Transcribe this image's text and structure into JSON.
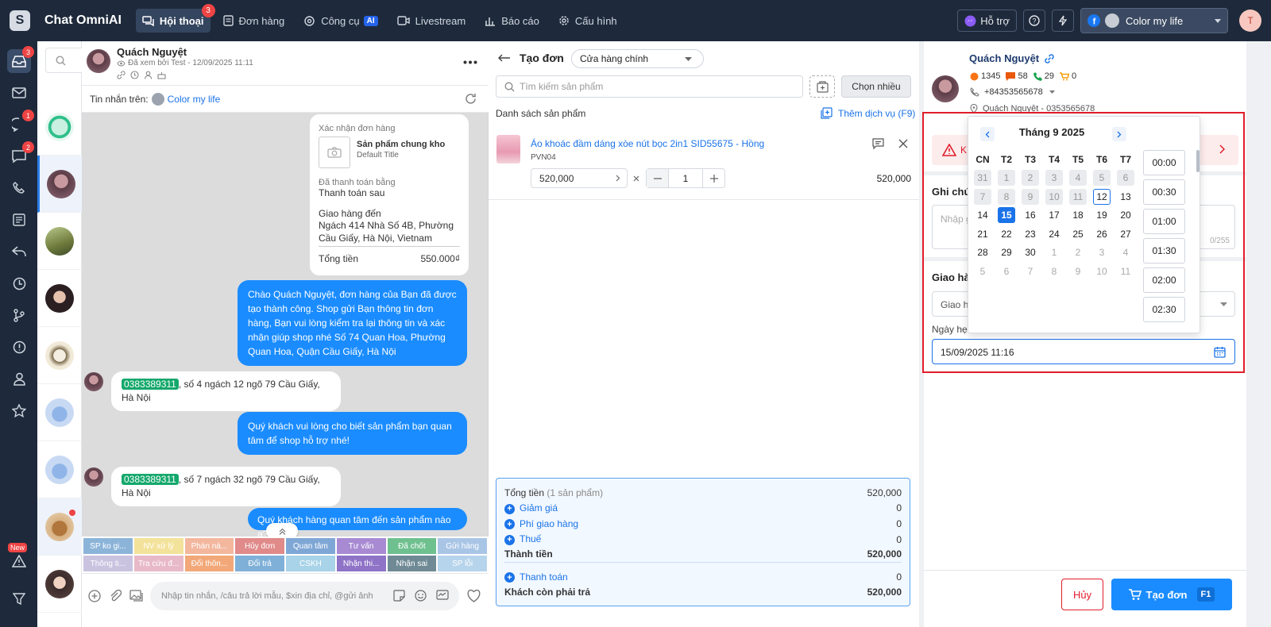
{
  "app": {
    "name": "Chat OmniAI",
    "logo": "S"
  },
  "nav": [
    {
      "label": "Hội thoại",
      "badge": "3",
      "icon": "chat-icon",
      "active": true
    },
    {
      "label": "Đơn hàng",
      "icon": "order-icon"
    },
    {
      "label": "Công cụ",
      "icon": "tools-icon",
      "ai": "AI"
    },
    {
      "label": "Livestream",
      "icon": "video-icon"
    },
    {
      "label": "Báo cáo",
      "icon": "chart-icon"
    },
    {
      "label": "Cấu hình",
      "icon": "gear-icon"
    }
  ],
  "topbar": {
    "support": "Hỗ trợ",
    "account": "Color my life",
    "user_initial": "T"
  },
  "rail": {
    "badges": {
      "inbox": "3",
      "messenger": "1",
      "comments": "2"
    },
    "new": "New"
  },
  "chat": {
    "name": "Quách Nguyệt",
    "seen": "Đã xem bởi Test - 12/09/2025 11:11",
    "via_label": "Tin nhắn trên:",
    "via_page": "Color my life",
    "order_card": {
      "title": "Xác nhận đơn hàng",
      "product": "Sản phẩm chung kho",
      "variant": "Default Title",
      "paid_label": "Đã thanh toán bằng",
      "paid_value": "Thanh toán sau",
      "ship_label": "Giao hàng đến",
      "ship_value": "Ngách 414 Nhà Số 4B, Phường Cầu Giấy, Hà Nội, Vietnam",
      "total_label": "Tổng tiền",
      "total_value": "550.000₫"
    },
    "msg1": "Chào Quách Nguyệt, đơn hàng của Bạn đã được tạo thành công. Shop gửi Bạn thông tin đơn hàng, Bạn vui lòng kiểm tra lại thông tin và xác nhận giúp shop nhé Số 74 Quan Hoa, Phường Quan Hoa, Quận Cầu Giấy, Hà Nội",
    "in1_phone": "0383389311",
    "in1_text": ", số 4 ngách 12 ngõ 79 Cầu Giấy, Hà Nội",
    "msg2": "Quý khách vui lòng cho biết sản phẩm bạn quan tâm để shop hỗ trợ nhé!",
    "in2_phone": "0383389311",
    "in2_text": ", số 7 ngách 32 ngõ 79 Cầu Giấy, Hà Nội",
    "msg3": "Quý khách hàng quan tâm đến sản phẩm nào ạ?",
    "quick_row1": [
      {
        "t": "SP ko gi...",
        "c": "#8cb4d9"
      },
      {
        "t": "NV xử lý",
        "c": "#f3e29a"
      },
      {
        "t": "Phàn nà...",
        "c": "#f3b79e"
      },
      {
        "t": "Hủy đơn",
        "c": "#e08a8a"
      },
      {
        "t": "Quan tâm",
        "c": "#7fa7d6"
      },
      {
        "t": "Tư vấn",
        "c": "#a88ad3"
      },
      {
        "t": "Đã chốt",
        "c": "#6fc08f"
      },
      {
        "t": "Gửi hàng",
        "c": "#a9c5e6"
      }
    ],
    "quick_row2": [
      {
        "t": "Thông ti...",
        "c": "#c9c3e0"
      },
      {
        "t": "Tra cứu đ...",
        "c": "#e8b9c8"
      },
      {
        "t": "Đổi thôn...",
        "c": "#f2a878"
      },
      {
        "t": "Đổi trả",
        "c": "#7fb0d8"
      },
      {
        "t": "CSKH",
        "c": "#a8d3e8"
      },
      {
        "t": "Nhận thi...",
        "c": "#8f73c7"
      },
      {
        "t": "Nhận sai",
        "c": "#6f8a95"
      },
      {
        "t": "SP lỗi",
        "c": "#b6d4ec"
      }
    ],
    "composer_placeholder": "Nhập tin nhắn, /câu trả lời mẫu, $xin địa chỉ, @gửi ảnh"
  },
  "order": {
    "title": "Tạo đơn",
    "store": "Cửa hàng chính",
    "search_placeholder": "Tìm kiếm sản phẩm",
    "bulk_btn": "Chọn nhiều",
    "list_label": "Danh sách sản phẩm",
    "add_service": "Thêm dịch vụ (F9)",
    "item": {
      "name": "Áo khoác đầm dáng xòe nút bọc 2in1 SID55675 - Hồng",
      "sku": "PVN04",
      "price": "520,000",
      "qty": "1",
      "total": "520,000"
    },
    "summary": {
      "total_label": "Tổng tiền",
      "total_count": "(1 sản phẩm)",
      "total_value": "520,000",
      "discount": "Giảm giá",
      "discount_v": "0",
      "shipping": "Phí giao hàng",
      "shipping_v": "0",
      "tax": "Thuế",
      "tax_v": "0",
      "subtotal": "Thành tiền",
      "subtotal_v": "520,000",
      "payment": "Thanh toán",
      "payment_v": "0",
      "remaining": "Khách còn phải trả",
      "remaining_v": "520,000"
    }
  },
  "customer": {
    "name": "Quách Nguyệt",
    "stats": [
      "1345",
      "58",
      "29",
      "0"
    ],
    "phone": "+84353565678",
    "address": "Quách Nguyệt - 0353565678",
    "alert": "K",
    "note_label": "Ghi chú",
    "note_placeholder": "Nhập g",
    "note_counter": "0/255",
    "ship_label": "Giao hà",
    "ship_select": "Giao h",
    "date_label": "Ngày hẹ",
    "date_value": "15/09/2025 11:16",
    "cancel": "Hủy",
    "create": "Tạo đơn",
    "create_key": "F1"
  },
  "picker": {
    "month": "Tháng 9 2025",
    "weekdays": [
      "CN",
      "T2",
      "T3",
      "T4",
      "T5",
      "T6",
      "T7"
    ],
    "rows": [
      [
        "31",
        "1",
        "2",
        "3",
        "4",
        "5",
        "6"
      ],
      [
        "7",
        "8",
        "9",
        "10",
        "11",
        "12",
        "13"
      ],
      [
        "14",
        "15",
        "16",
        "17",
        "18",
        "19",
        "20"
      ],
      [
        "21",
        "22",
        "23",
        "24",
        "25",
        "26",
        "27"
      ],
      [
        "28",
        "29",
        "30",
        "1",
        "2",
        "3",
        "4"
      ],
      [
        "5",
        "6",
        "7",
        "8",
        "9",
        "10",
        "11"
      ]
    ],
    "times": [
      "00:00",
      "00:30",
      "01:00",
      "01:30",
      "02:00",
      "02:30"
    ]
  }
}
